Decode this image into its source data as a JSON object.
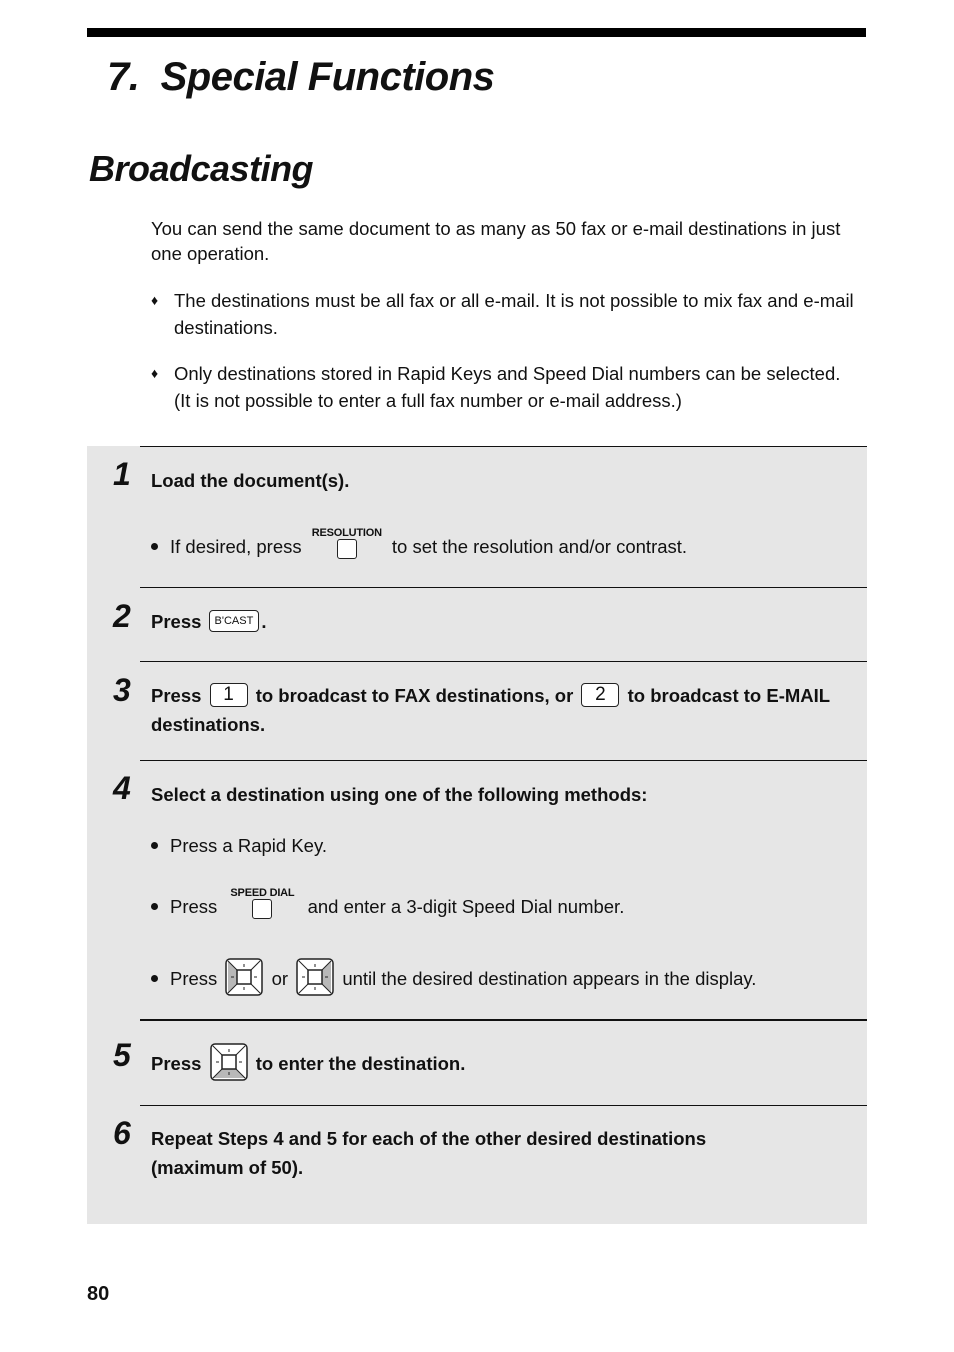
{
  "chapter": {
    "title": "7.  Special Functions"
  },
  "section": {
    "title": "Broadcasting"
  },
  "intro": "You can send the same document to as many as 50 fax or e-mail destinations in just one operation.",
  "notes": [
    {
      "icon": "diamond-bullet-icon",
      "symbol": "♦",
      "text": "The destinations must be all fax or all e-mail. It is not possible to mix fax and e-mail destinations."
    },
    {
      "icon": "diamond-bullet-icon",
      "symbol": "♦",
      "text": "Only destinations stored in Rapid Keys and Speed Dial numbers can be selected. (It is not possible to enter a full fax number or e-mail address.)"
    }
  ],
  "steps": [
    {
      "number": "1",
      "text": "Load the document(s).",
      "bullets": [
        {
          "before": "If desired, press",
          "key_label": "RESOLUTION",
          "after": "to set the resolution and/or contrast."
        }
      ]
    },
    {
      "number": "2",
      "text_before": "Press",
      "key_label": "B'CAST",
      "text_after": "."
    },
    {
      "number": "3",
      "text_a": "Press",
      "key1": "1",
      "text_b": "to broadcast to FAX destinations, or",
      "key2": "2",
      "text_c": "to broadcast to E-MAIL destinations."
    },
    {
      "number": "4",
      "text": "Select a destination using one of the following methods:",
      "bullets": [
        {
          "text": "Press a Rapid Key."
        },
        {
          "before": "Press",
          "key_label": "SPEED DIAL",
          "after": "and enter a 3-digit Speed Dial number."
        },
        {
          "before": "Press",
          "key_a": "left-arrow-key-icon",
          "middle": "or",
          "key_b": "right-arrow-key-icon",
          "after": "until the desired destination appears in the display."
        }
      ]
    },
    {
      "number": "5",
      "text_before": "Press",
      "key": "enter-key-icon",
      "text_after": "to enter the destination."
    },
    {
      "number": "6",
      "text": "Repeat Steps 4 and 5 for each of the other desired destinations (maximum of 50)."
    }
  ],
  "page_number": "80",
  "colors": {
    "panel_bg": "#e6e6e6",
    "rule": "#000000",
    "key_shade": "#b8b8b8"
  }
}
